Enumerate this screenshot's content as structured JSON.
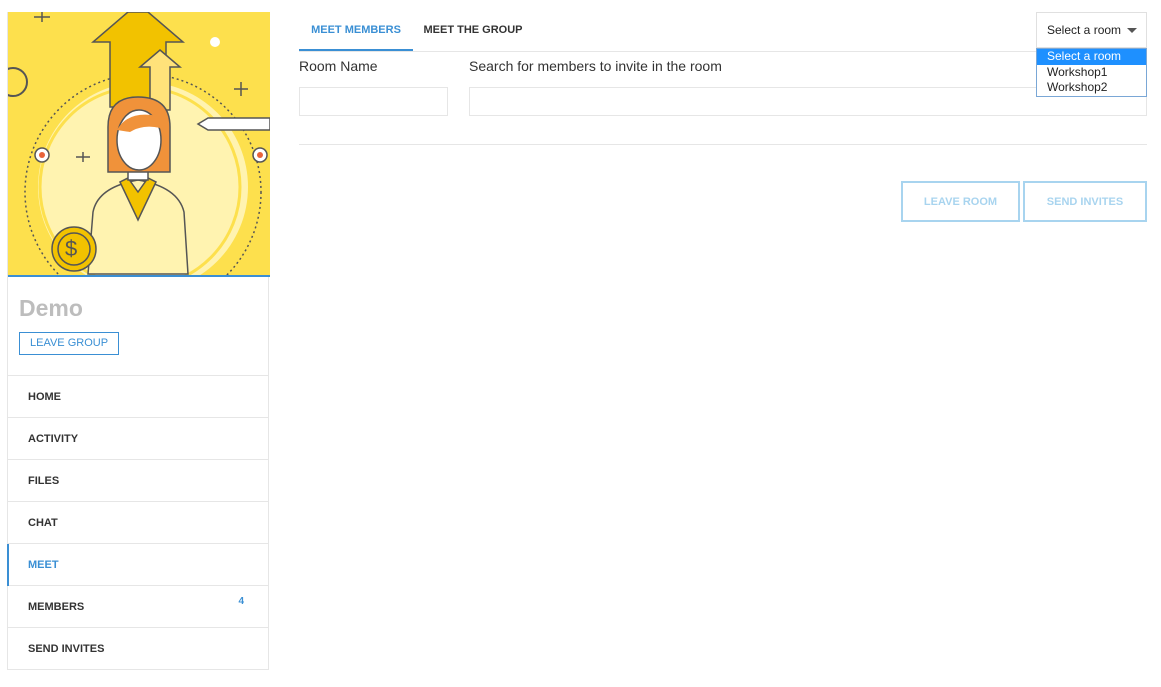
{
  "group": {
    "name": "Demo",
    "leave_label": "LEAVE GROUP",
    "currency_symbol": "$"
  },
  "nav": {
    "items": [
      {
        "label": "HOME"
      },
      {
        "label": "ACTIVITY"
      },
      {
        "label": "FILES"
      },
      {
        "label": "CHAT"
      },
      {
        "label": "MEET",
        "active": true
      },
      {
        "label": "MEMBERS",
        "badge": "4"
      },
      {
        "label": "SEND INVITES"
      }
    ]
  },
  "tabs": {
    "meet_members": "MEET MEMBERS",
    "meet_group": "MEET THE GROUP"
  },
  "room_select": {
    "value": "Select a room",
    "options": [
      "Select a room",
      "Workshop1",
      "Workshop2"
    ]
  },
  "form": {
    "room_name_label": "Room Name",
    "search_label": "Search for members to invite in the room"
  },
  "actions": {
    "leave_room": "LEAVE ROOM",
    "send_invites": "SEND INVITES"
  },
  "colors": {
    "accent": "#3a8fd4",
    "banner": "#fde04d",
    "disabled": "#a8d4ef"
  }
}
